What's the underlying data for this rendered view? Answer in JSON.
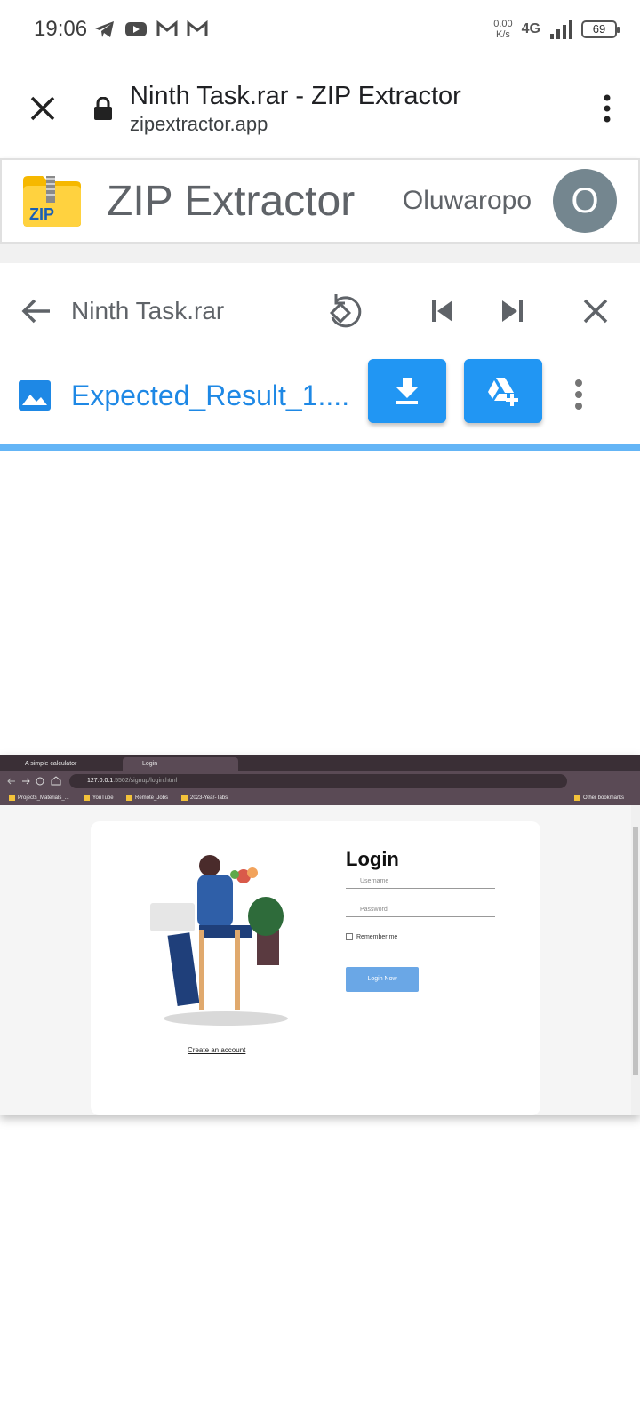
{
  "status_bar": {
    "time": "19:06",
    "notification_icons": [
      "telegram-icon",
      "youtube-icon",
      "gmail-icon",
      "gmail-icon"
    ],
    "net_speed_value": "0.00",
    "net_speed_unit": "K/s",
    "network": "4G",
    "battery": "69"
  },
  "browser": {
    "page_title": "Ninth Task.rar - ZIP Extractor",
    "domain": "zipextractor.app"
  },
  "app_header": {
    "logo_text": "ZIP",
    "title": "ZIP Extractor",
    "user_name": "Oluwaropo",
    "avatar_letter": "O"
  },
  "archive_toolbar": {
    "archive_name": "Ninth Task.rar"
  },
  "file_row": {
    "file_name": "Expected_Result_1...."
  },
  "colors": {
    "accent": "#2196f3",
    "file_link": "#1e88e5",
    "progress": "#64b5f6",
    "avatar": "#74868f"
  },
  "preview": {
    "tabs": [
      "A simple calculator",
      "Login"
    ],
    "url_host": "127.0.0.1",
    "url_path": ":5502/signup/login.html",
    "bookmarks": [
      "Projects_Materials_...",
      "YouTube",
      "Remote_Jobs",
      "2023-Year-Tabs"
    ],
    "other_bookmarks": "Other bookmarks",
    "login": {
      "title": "Login",
      "username_placeholder": "Username",
      "password_placeholder": "Password",
      "remember_label": "Remember me",
      "button_label": "Login Now",
      "create_account_link": "Create an account"
    }
  }
}
